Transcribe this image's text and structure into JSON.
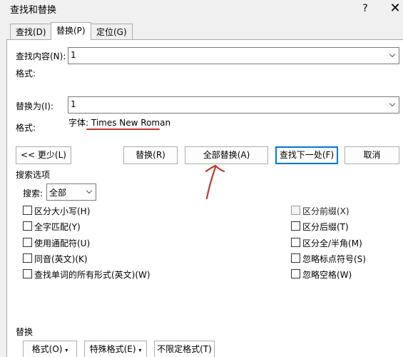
{
  "window": {
    "title": "查找和替换",
    "help_label": "?",
    "close_label": "✕"
  },
  "tabs": [
    {
      "label": "查找(D)",
      "active": false
    },
    {
      "label": "替换(P)",
      "active": true
    },
    {
      "label": "定位(G)",
      "active": false
    }
  ],
  "find": {
    "label": "查找内容(N):",
    "value": "1",
    "format_label": "格式:"
  },
  "replace": {
    "label": "替换为(I):",
    "value": "1",
    "format_label": "格式:",
    "format_value": "字体: Times New Roman"
  },
  "buttons": {
    "less": "<< 更少(L)",
    "replace": "替换(R)",
    "replace_all": "全部替换(A)",
    "find_next": "查找下一处(F)",
    "cancel": "取消"
  },
  "search_options": {
    "heading": "搜索选项",
    "search_label": "搜索:",
    "search_value": "全部",
    "left_checkboxes": [
      {
        "label": "区分大小写(H)",
        "checked": false
      },
      {
        "label": "全字匹配(Y)",
        "checked": false
      },
      {
        "label": "使用通配符(U)",
        "checked": false
      },
      {
        "label": "同音(英文)(K)",
        "checked": false
      },
      {
        "label": "查找单词的所有形式(英文)(W)",
        "checked": false
      }
    ],
    "right_checkboxes": [
      {
        "label": "区分前缀(X)",
        "checked": false
      },
      {
        "label": "区分后缀(T)",
        "checked": false
      },
      {
        "label": "区分全/半角(M)",
        "checked": false
      },
      {
        "label": "忽略标点符号(S)",
        "checked": false
      },
      {
        "label": "忽略空格(W)",
        "checked": false
      }
    ]
  },
  "replace_section": {
    "heading": "替换",
    "format_button": "格式(O)",
    "special_button": "特殊格式(E)",
    "no_format_button": "不限定格式(T)"
  },
  "colors": {
    "accent": "#0078d7",
    "annotation": "#c0392b"
  }
}
